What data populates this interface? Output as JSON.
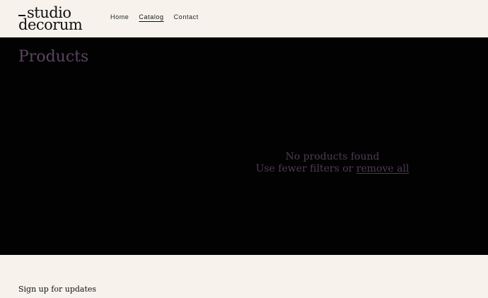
{
  "header": {
    "logo_line1": "studio",
    "logo_line2": "decorum",
    "nav": [
      {
        "label": "Home"
      },
      {
        "label": "Catalog"
      },
      {
        "label": "Contact"
      }
    ]
  },
  "main": {
    "title": "Products",
    "empty_title": "No products found",
    "empty_prefix": "Use fewer filters or ",
    "empty_link": "remove all"
  },
  "footer": {
    "signup_heading": "Sign up for updates"
  },
  "colors": {
    "background": "#f7f3ec",
    "main_background": "#020202",
    "accent": "#5b4463"
  }
}
